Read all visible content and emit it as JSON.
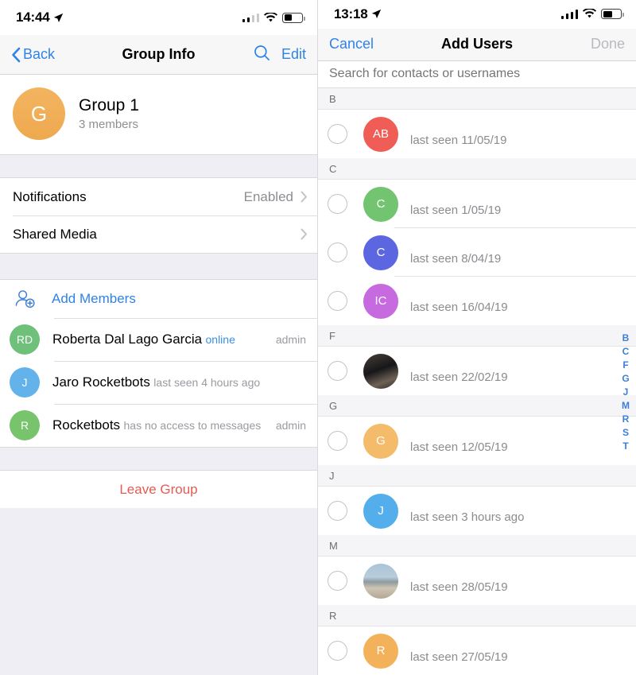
{
  "left": {
    "status_bar": {
      "time": "14:44",
      "location_icon": "location-arrow-icon",
      "signal_icon": "signal-bars-icon",
      "signal_bars": 2,
      "wifi_icon": "wifi-icon",
      "battery_icon": "battery-icon",
      "battery_level": 45
    },
    "navbar": {
      "back_label": "Back",
      "back_icon": "chevron-left-icon",
      "title": "Group Info",
      "search_icon": "search-icon",
      "edit_label": "Edit"
    },
    "group": {
      "avatar_initial": "G",
      "avatar_color": "#f0ad55",
      "name": "Group 1",
      "members_count": "3 members"
    },
    "settings": [
      {
        "label": "Notifications",
        "value": "Enabled",
        "chevron": "chevron-right-icon"
      },
      {
        "label": "Shared Media",
        "value": "",
        "chevron": "chevron-right-icon"
      }
    ],
    "add_members": {
      "icon": "add-person-icon",
      "label": "Add Members"
    },
    "members": [
      {
        "initials": "RD",
        "avatar_color": "#6fc07a",
        "name": "Roberta Dal Lago Garcia",
        "status": "online",
        "status_type": "online",
        "badge": "admin"
      },
      {
        "initials": "J",
        "avatar_color": "#63b3ea",
        "name": "Jaro Rocketbots",
        "status": "last seen 4 hours ago",
        "status_type": "offline",
        "badge": ""
      },
      {
        "initials": "R",
        "avatar_color": "#77c46c",
        "name": "Rocketbots",
        "status": "has no access to messages",
        "status_type": "offline",
        "badge": "admin"
      }
    ],
    "leave": {
      "label": "Leave Group",
      "color": "#e35b55"
    }
  },
  "right": {
    "status_bar": {
      "time": "13:18",
      "location_icon": "location-arrow-icon",
      "signal_icon": "signal-bars-icon",
      "signal_bars": 4,
      "wifi_icon": "wifi-icon",
      "battery_icon": "battery-icon",
      "battery_level": 55
    },
    "navbar": {
      "cancel_label": "Cancel",
      "title": "Add Users",
      "done_label": "Done",
      "done_enabled": false
    },
    "search": {
      "placeholder": "Search for contacts or usernames",
      "value": ""
    },
    "sections": [
      {
        "letter": "B",
        "contacts": [
          {
            "avatar_type": "initials",
            "initials": "AB",
            "avatar_color": "#ef5d56",
            "status": "last seen 11/05/19",
            "checked": false
          }
        ]
      },
      {
        "letter": "C",
        "contacts": [
          {
            "avatar_type": "initials",
            "initials": "C",
            "avatar_color": "#72c471",
            "status": "last seen 1/05/19",
            "checked": false
          },
          {
            "avatar_type": "initials",
            "initials": "C",
            "avatar_color": "#5b66e0",
            "status": "last seen 8/04/19",
            "checked": false
          },
          {
            "avatar_type": "initials",
            "initials": "IC",
            "avatar_color": "#c76ae0",
            "status": "last seen 16/04/19",
            "checked": false
          }
        ]
      },
      {
        "letter": "F",
        "contacts": [
          {
            "avatar_type": "photo",
            "photo": "photo-dark",
            "initials": "",
            "avatar_color": "",
            "status": "last seen 22/02/19",
            "checked": false
          }
        ]
      },
      {
        "letter": "G",
        "contacts": [
          {
            "avatar_type": "initials",
            "initials": "G",
            "avatar_color": "#f3bb6a",
            "status": "last seen 12/05/19",
            "checked": false
          }
        ]
      },
      {
        "letter": "J",
        "contacts": [
          {
            "avatar_type": "initials",
            "initials": "J",
            "avatar_color": "#54aeec",
            "status": "last seen 3 hours ago",
            "checked": false
          }
        ]
      },
      {
        "letter": "M",
        "contacts": [
          {
            "avatar_type": "photo",
            "photo": "photo-beach",
            "initials": "",
            "avatar_color": "",
            "status": "last seen 28/05/19",
            "checked": false
          }
        ]
      },
      {
        "letter": "R",
        "contacts": [
          {
            "avatar_type": "initials",
            "initials": "R",
            "avatar_color": "#f3b25a",
            "status": "last seen 27/05/19",
            "checked": false
          }
        ]
      }
    ],
    "index_rail": [
      "B",
      "C",
      "F",
      "G",
      "J",
      "M",
      "R",
      "S",
      "T"
    ]
  }
}
